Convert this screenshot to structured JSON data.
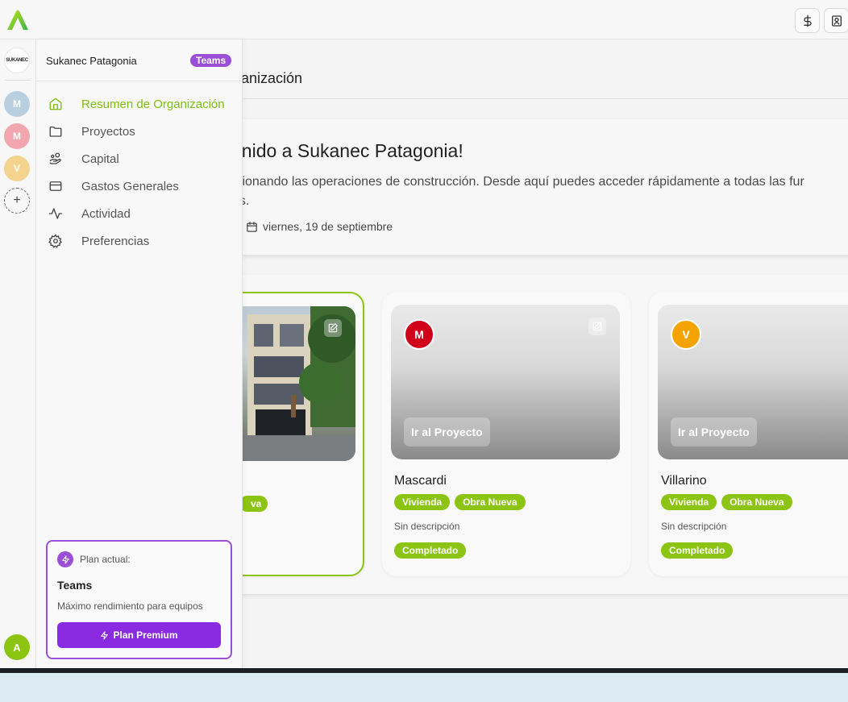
{
  "colors": {
    "accent": "#8bc412",
    "purple": "#8a2be2",
    "badge_purple": "#9b4fd6"
  },
  "rail": {
    "org_logo_text": "SUKANEC",
    "avatars": [
      {
        "letter": "M",
        "color": "#b9cfe0"
      },
      {
        "letter": "M",
        "color": "#f1a6ad"
      },
      {
        "letter": "V",
        "color": "#f4d38f"
      }
    ],
    "add_label": "+",
    "user_letter": "A"
  },
  "panel": {
    "org_name": "Sukanec Patagonia",
    "badge": "Teams",
    "nav": [
      {
        "label": "Resumen de Organización",
        "icon": "home-icon",
        "active": true
      },
      {
        "label": "Proyectos",
        "icon": "folder-icon"
      },
      {
        "label": "Capital",
        "icon": "hand-coins-icon"
      },
      {
        "label": "Gastos Generales",
        "icon": "credit-card-icon"
      },
      {
        "label": "Actividad",
        "icon": "activity-icon"
      },
      {
        "label": "Preferencias",
        "icon": "gear-icon"
      }
    ],
    "plan": {
      "label": "Plan actual:",
      "title": "Teams",
      "description": "Máximo rendimiento para equipos",
      "button": "Plan Premium"
    }
  },
  "main": {
    "title": "ganización",
    "welcome_title": "enido a Sukanec Patagonia!",
    "welcome_text": "stionando las operaciones de construcción. Desde aquí puedes acceder rápidamente a todas las fur",
    "welcome_text_2": "es.",
    "date": "viernes, 19 de septiembre"
  },
  "projects": [
    {
      "tag_partial": "va"
    },
    {
      "name": "Mascardi",
      "avatar": "M",
      "avatar_color": "#d0021b",
      "go_label": "Ir al Proyecto",
      "tags": [
        "Vivienda",
        "Obra Nueva"
      ],
      "description": "Sin descripción",
      "status": "Completado"
    },
    {
      "name": "Villarino",
      "avatar": "V",
      "avatar_color": "#f5a300",
      "go_label": "Ir al Proyecto",
      "tags": [
        "Vivienda",
        "Obra Nueva"
      ],
      "description": "Sin descripción",
      "status": "Completado"
    }
  ]
}
